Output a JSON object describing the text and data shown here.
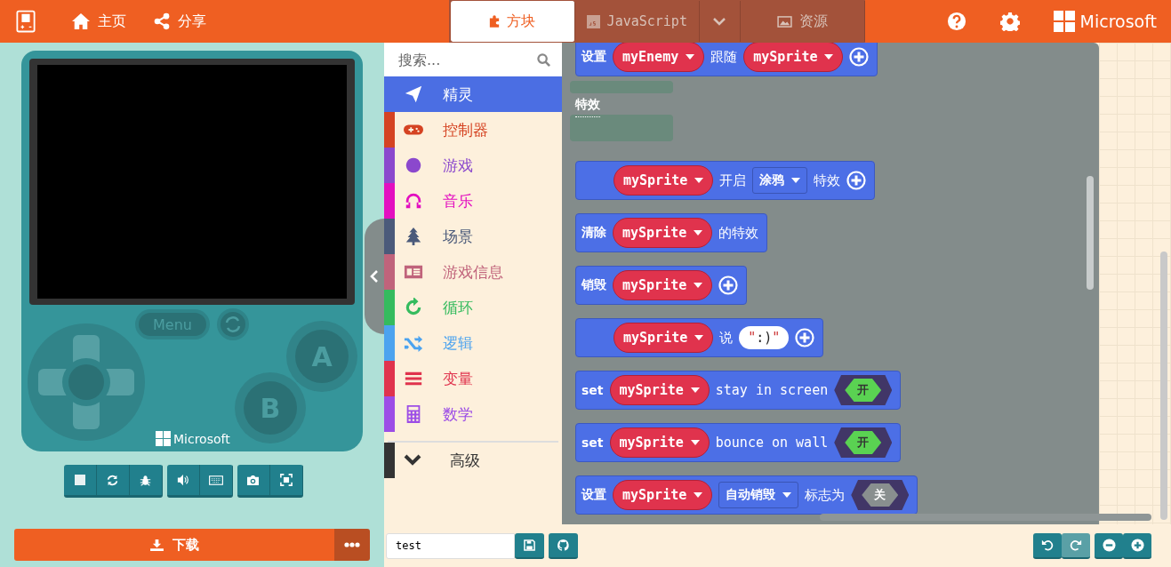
{
  "header": {
    "nav": [
      {
        "label": "主页"
      },
      {
        "label": "分享"
      }
    ],
    "tabs": [
      {
        "label": "方块",
        "selected": true
      },
      {
        "label": "JavaScript",
        "selected": false
      },
      {
        "label": "资源",
        "selected": false
      }
    ],
    "brand": "Microsoft"
  },
  "simulator": {
    "menu": "Menu",
    "buttons": [
      "A",
      "B"
    ],
    "brand": "Microsoft",
    "download": "下载"
  },
  "toolbox": {
    "search": {
      "placeholder": "搜索..."
    },
    "categories": [
      {
        "label": "精灵",
        "color": "#4b6ee3",
        "selected": true
      },
      {
        "label": "控制器",
        "color": "#d54322",
        "selected": false
      },
      {
        "label": "游戏",
        "color": "#8b48cd",
        "selected": false
      },
      {
        "label": "音乐",
        "color": "#e30fc0",
        "selected": false
      },
      {
        "label": "场景",
        "color": "#4b5a7a",
        "selected": false
      },
      {
        "label": "游戏信息",
        "color": "#c0637b",
        "selected": false
      },
      {
        "label": "循环",
        "color": "#35bb5e",
        "selected": false
      },
      {
        "label": "逻辑",
        "color": "#4ca3ef",
        "selected": false
      },
      {
        "label": "变量",
        "color": "#e0334d",
        "selected": false
      },
      {
        "label": "数学",
        "color": "#9c4de6",
        "selected": false
      }
    ],
    "advanced": {
      "label": "高级"
    }
  },
  "flyout": {
    "items": [
      {
        "kind": "block",
        "indent": false,
        "parts": [
          {
            "kind": "text",
            "text": "设置"
          },
          {
            "kind": "variable",
            "text": "myEnemy"
          },
          {
            "kind": "text",
            "text": "跟随"
          },
          {
            "kind": "variable",
            "text": "mySprite"
          },
          {
            "kind": "add"
          }
        ]
      },
      {
        "kind": "heading",
        "text": "特效"
      },
      {
        "kind": "block",
        "indent": true,
        "parts": [
          {
            "kind": "variable",
            "text": "mySprite"
          },
          {
            "kind": "text",
            "text": "开启"
          },
          {
            "kind": "dropdown",
            "text": "涂鸦"
          },
          {
            "kind": "text",
            "text": "特效"
          },
          {
            "kind": "add"
          }
        ]
      },
      {
        "kind": "block",
        "indent": false,
        "parts": [
          {
            "kind": "text",
            "text": "清除"
          },
          {
            "kind": "variable",
            "text": "mySprite"
          },
          {
            "kind": "text",
            "text": "的特效"
          }
        ]
      },
      {
        "kind": "block",
        "indent": false,
        "parts": [
          {
            "kind": "text",
            "text": "销毁"
          },
          {
            "kind": "variable",
            "text": "mySprite"
          },
          {
            "kind": "add"
          }
        ]
      },
      {
        "kind": "block",
        "indent": true,
        "parts": [
          {
            "kind": "variable",
            "text": "mySprite"
          },
          {
            "kind": "text",
            "text": "说"
          },
          {
            "kind": "string",
            "text": ":)",
            "quote": "\""
          },
          {
            "kind": "add"
          }
        ]
      },
      {
        "kind": "block",
        "indent": false,
        "parts": [
          {
            "kind": "text",
            "text": "set"
          },
          {
            "kind": "variable",
            "text": "mySprite"
          },
          {
            "kind": "text",
            "text": "stay in screen"
          },
          {
            "kind": "toggle",
            "text": "开",
            "on": true
          }
        ]
      },
      {
        "kind": "block",
        "indent": false,
        "parts": [
          {
            "kind": "text",
            "text": "set"
          },
          {
            "kind": "variable",
            "text": "mySprite"
          },
          {
            "kind": "text",
            "text": "bounce on wall"
          },
          {
            "kind": "toggle",
            "text": "开",
            "on": true
          }
        ]
      },
      {
        "kind": "block",
        "indent": false,
        "parts": [
          {
            "kind": "text",
            "text": "设置"
          },
          {
            "kind": "variable",
            "text": "mySprite"
          },
          {
            "kind": "dropdown",
            "text": "自动销毁"
          },
          {
            "kind": "text",
            "text": "标志为"
          },
          {
            "kind": "toggle",
            "text": "关",
            "on": false
          }
        ]
      }
    ]
  },
  "footer": {
    "project_name": "test"
  }
}
